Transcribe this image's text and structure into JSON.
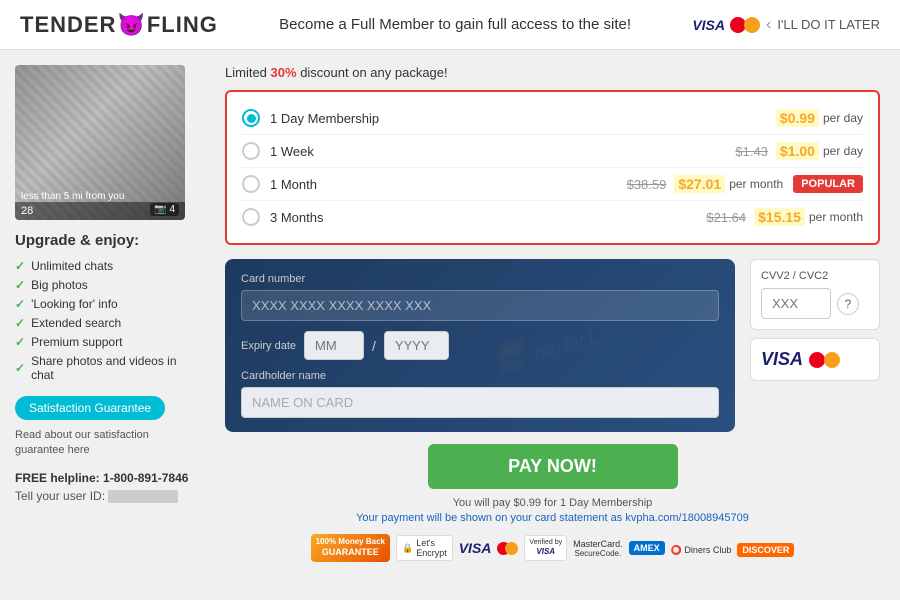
{
  "header": {
    "logo_text1": "TENDER",
    "logo_text2": "FLING",
    "headline": "Become a Full Member to gain full access to the site!",
    "later_label": "I'LL DO IT LATER"
  },
  "left": {
    "profile_age": "28",
    "profile_distance": "less than 5 mi from you",
    "photo_count": "4",
    "upgrade_title": "Upgrade & enjoy:",
    "features": [
      "Unlimited chats",
      "Big photos",
      "'Looking for' info",
      "Extended search",
      "Premium support",
      "Share photos and videos in chat"
    ],
    "satisfaction_btn": "Satisfaction Guarantee",
    "satisfaction_text": "Read about our satisfaction guarantee here",
    "helpline_label": "FREE helpline:",
    "helpline_number": "1-800-891-7846",
    "user_id_label": "Tell your user ID:"
  },
  "pricing": {
    "discount_text1": "Limited ",
    "discount_pct": "30%",
    "discount_text2": " discount on any package!",
    "plans": [
      {
        "id": "1day",
        "name": "1 Day Membership",
        "original": "",
        "sale": "$0.99",
        "unit": "per day",
        "selected": true,
        "popular": false
      },
      {
        "id": "1week",
        "name": "1 Week",
        "original": "$1.43",
        "sale": "$1.00",
        "unit": "per day",
        "selected": false,
        "popular": false
      },
      {
        "id": "1month",
        "name": "1 Month",
        "original": "$38.59",
        "sale": "$27.01",
        "unit": "per month",
        "selected": false,
        "popular": true,
        "popular_label": "POPULAR"
      },
      {
        "id": "3months",
        "name": "3 Months",
        "original": "$21.64",
        "sale": "$15.15",
        "unit": "per month",
        "selected": false,
        "popular": false
      }
    ]
  },
  "payment": {
    "card_number_label": "Card number",
    "card_number_placeholder": "XXXX XXXX XXXX XXXX XXX",
    "expiry_label": "Expiry date",
    "expiry_mm": "MM",
    "expiry_yyyy": "YYYY",
    "cardholder_label": "Cardholder name",
    "cardholder_placeholder": "NAME ON CARD",
    "cvv_label": "CVV2 / CVC2",
    "cvv_placeholder": "XXX",
    "pay_btn": "PAY NOW!",
    "pay_note": "You will pay $0.99 for 1 Day Membership",
    "pay_statement": "Your payment will be shown on your card statement as ",
    "pay_statement_domain": "kvpha.com/18008945709"
  }
}
